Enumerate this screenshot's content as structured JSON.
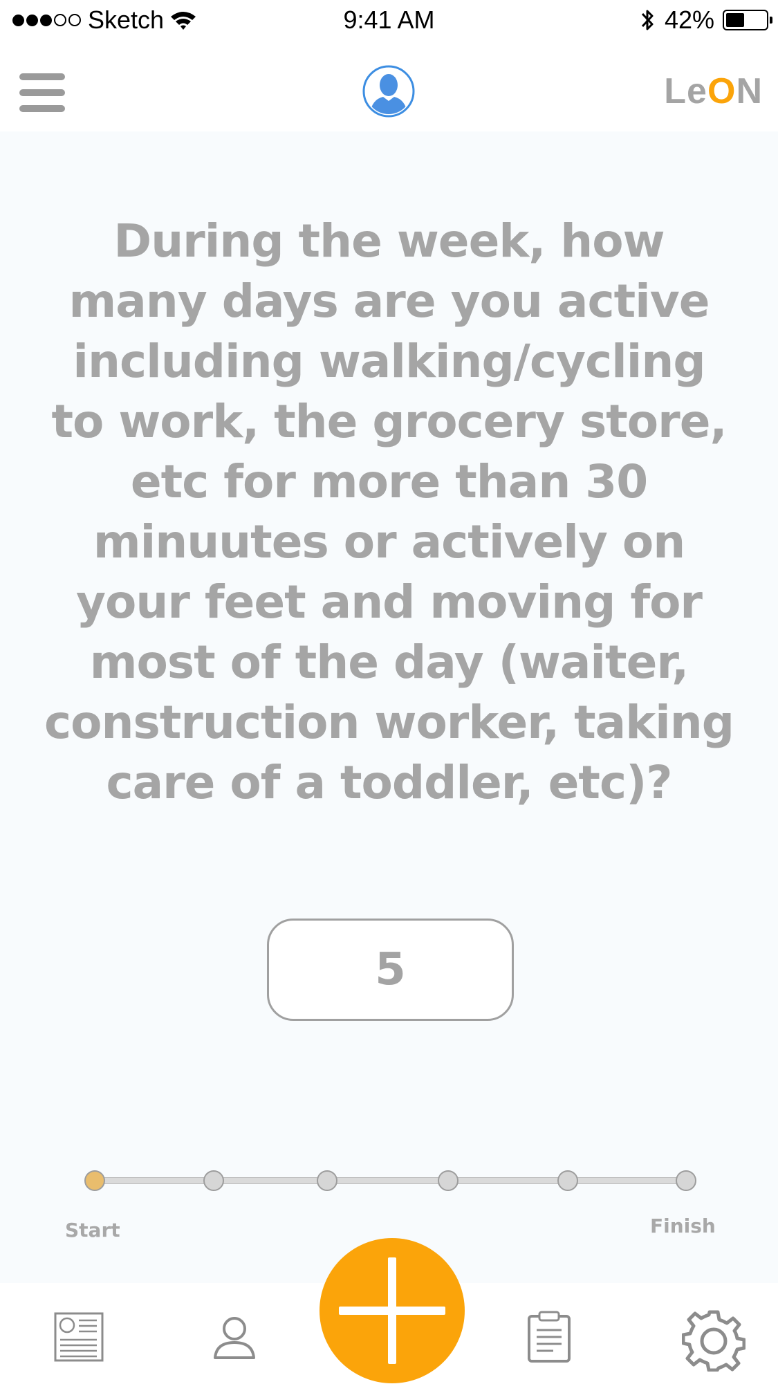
{
  "status_bar": {
    "carrier": "Sketch",
    "time": "9:41 AM",
    "battery_percent": "42%",
    "battery_level": 0.42,
    "signal_bars_filled": 3,
    "signal_bars_total": 5
  },
  "header": {
    "brand_part1": "Le",
    "brand_accent": "O",
    "brand_part2": "N",
    "brand_accent_color": "#fba40a"
  },
  "question": {
    "text": "During the week, how many days are you active including walking/cycling to work, the grocery store, etc for more than 30 minuutes or actively on your feet and moving for most of the day (waiter, construction worker, taking care of a toddler, etc)?"
  },
  "answer": {
    "value": "5"
  },
  "progress": {
    "start_label": "Start",
    "finish_label": "Finish",
    "steps_total": 6,
    "current_step": 1
  },
  "tab_bar": {
    "items": [
      {
        "icon": "news-icon"
      },
      {
        "icon": "profile-icon"
      },
      {
        "icon": "add-icon"
      },
      {
        "icon": "clipboard-icon"
      },
      {
        "icon": "settings-icon"
      }
    ],
    "accent_color": "#fba40a"
  }
}
